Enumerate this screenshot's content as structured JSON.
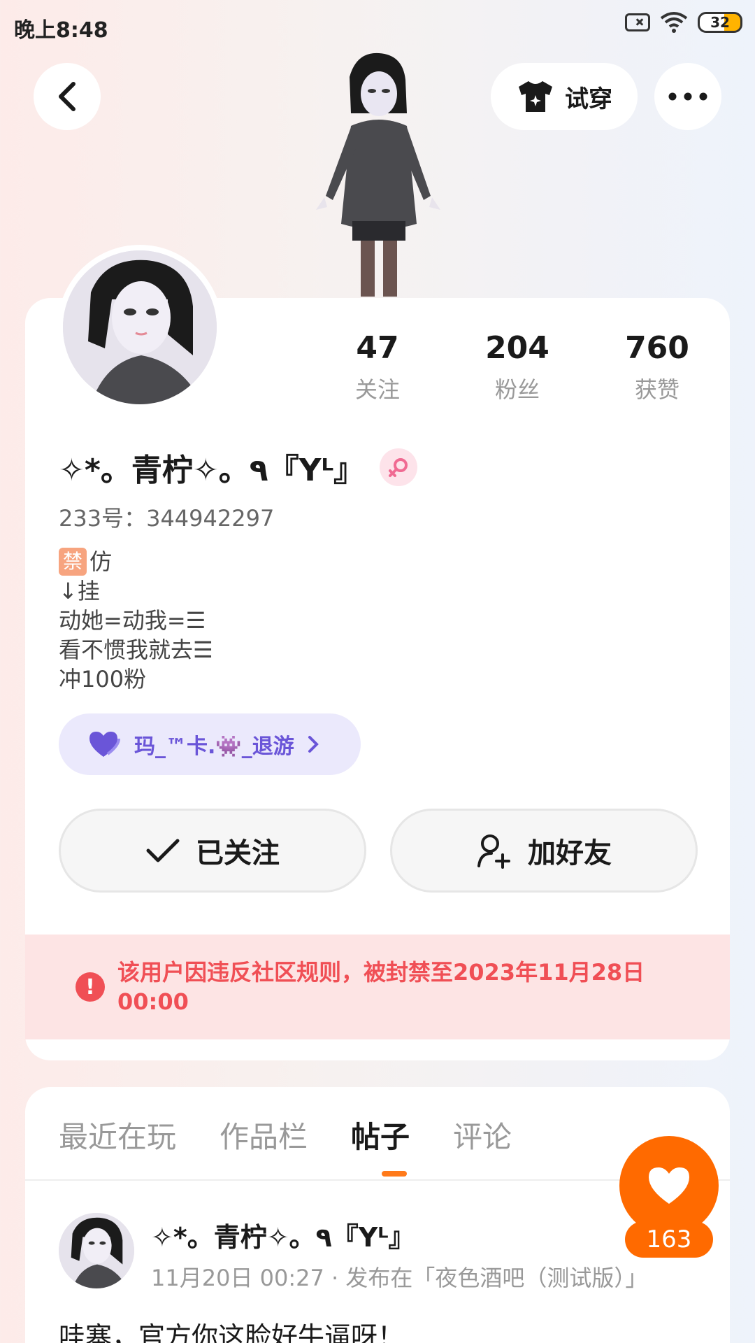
{
  "status_bar": {
    "time": "晚上8:48",
    "battery": "32"
  },
  "header": {
    "try_on_label": "试穿"
  },
  "profile": {
    "stats": [
      {
        "value": "47",
        "label": "关注"
      },
      {
        "value": "204",
        "label": "粉丝"
      },
      {
        "value": "760",
        "label": "获赞"
      }
    ],
    "nickname": "✧*。青柠✧。٩『Yᴸ』",
    "uid": "233号：344942297",
    "bio": {
      "ban_tag": "禁",
      "lines": [
        "仿",
        "↓挂",
        "动她=动我=☰",
        "看不惯我就去☰",
        "冲100粉"
      ]
    },
    "guild": "玛_™卡.👾_退游",
    "follow_button": "已关注",
    "add_friend_button": "加好友"
  },
  "ban_notice": {
    "icon": "!",
    "text": "该用户因违反社区规则，被封禁至2023年11月28日 00:00"
  },
  "tabs": [
    {
      "label": "最近在玩",
      "active": false
    },
    {
      "label": "作品栏",
      "active": false
    },
    {
      "label": "帖子",
      "active": true
    },
    {
      "label": "评论",
      "active": false
    }
  ],
  "post": {
    "author": "✧*。青柠✧。٩『Yᴸ』",
    "meta": "11月20日 00:27 · 发布在「夜色酒吧（测试版）」",
    "text": "哇塞，官方你这脸好牛逼呀！"
  },
  "like": {
    "count": "163"
  },
  "colors": {
    "accent_orange": "#ff6a00",
    "ban_red": "#f04f55",
    "guild_purple": "#6a55d8"
  }
}
